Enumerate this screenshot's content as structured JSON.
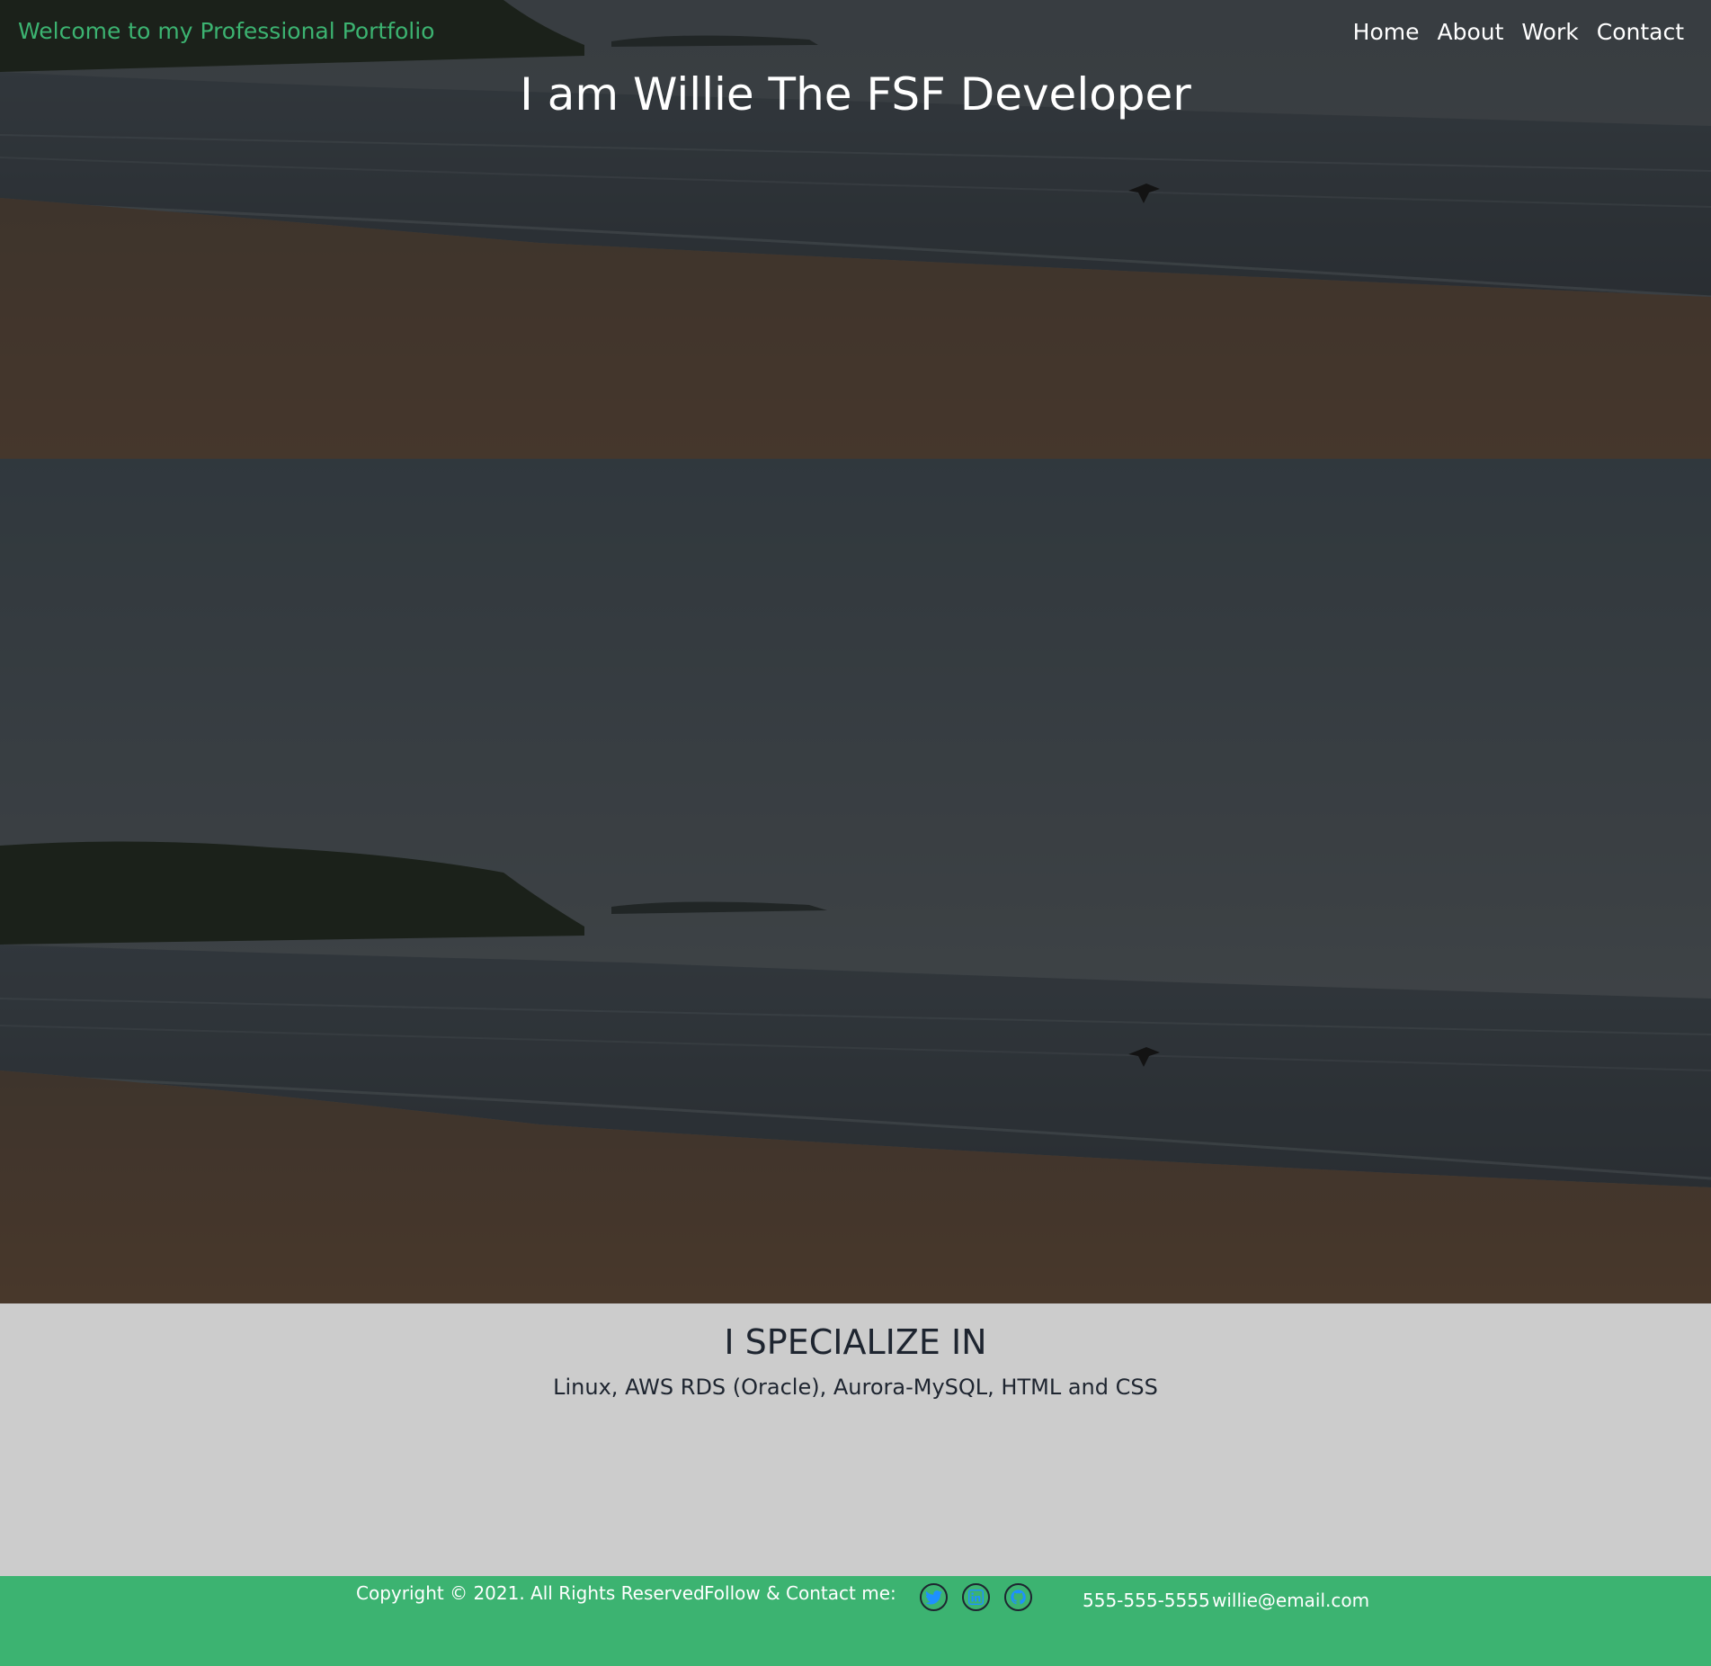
{
  "header": {
    "brand": "Welcome to my Professional Portfolio",
    "nav": [
      {
        "label": "Home"
      },
      {
        "label": "About"
      },
      {
        "label": "Work"
      },
      {
        "label": "Contact"
      }
    ]
  },
  "hero": {
    "title": "I am Willie The FSF Developer"
  },
  "specialize": {
    "heading": "I SPECIALIZE IN",
    "text": "Linux, AWS RDS (Oracle), Aurora-MySQL, HTML and CSS"
  },
  "footer": {
    "copyright": "Copyright © 2021. All Rights Reserved",
    "follow": "Follow & Contact me:",
    "social": [
      {
        "icon": "twitter-icon"
      },
      {
        "icon": "linkedin-icon"
      },
      {
        "icon": "github-icon"
      }
    ],
    "phone": "555-555-5555",
    "email": "willie@email.com"
  },
  "colors": {
    "accent_green": "#3cb371",
    "section_gray": "#cccccc",
    "text_dark": "#1e2530",
    "icon_blue": "#1e90ff"
  }
}
